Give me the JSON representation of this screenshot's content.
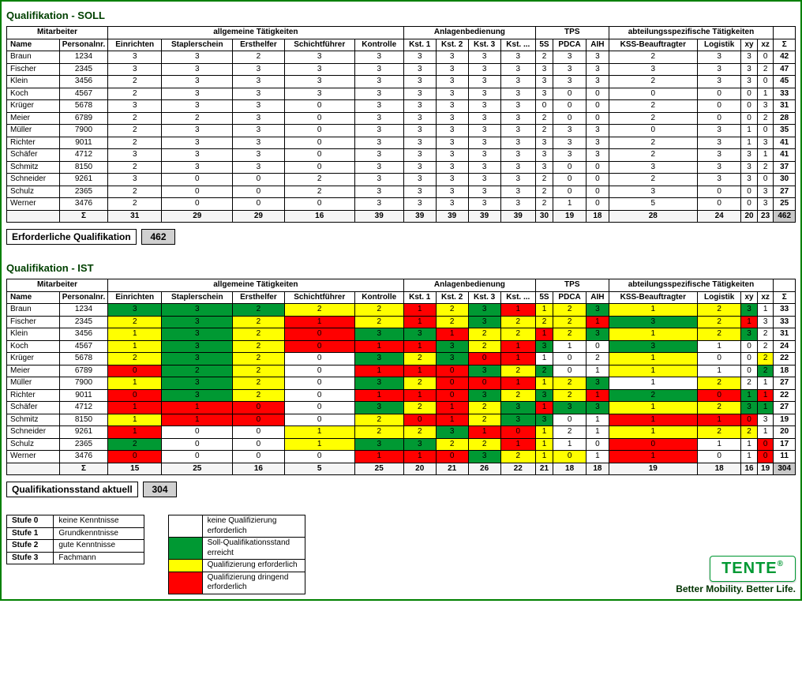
{
  "soll": {
    "title": "Qualifikation - SOLL",
    "groupHeaders": [
      "Mitarbeiter",
      "allgemeine Tätigkeiten",
      "Anlagenbedienung",
      "TPS",
      "abteilungsspezifische Tätigkeiten",
      ""
    ],
    "cols": [
      "Name",
      "Personalnr.",
      "Einrichten",
      "Staplerschein",
      "Ersthelfer",
      "Schichtführer",
      "Kontrolle",
      "Kst. 1",
      "Kst. 2",
      "Kst. 3",
      "Kst. ...",
      "5S",
      "PDCA",
      "AIH",
      "KSS-Beauftragter",
      "Logistik",
      "xy",
      "xz",
      "Σ"
    ],
    "rows": [
      {
        "name": "Braun",
        "pnr": "1234",
        "v": [
          3,
          3,
          2,
          3,
          3,
          3,
          3,
          3,
          3,
          2,
          3,
          3,
          2,
          3,
          3,
          0
        ],
        "sum": 42
      },
      {
        "name": "Fischer",
        "pnr": "2345",
        "v": [
          3,
          3,
          3,
          3,
          3,
          3,
          3,
          3,
          3,
          3,
          3,
          3,
          3,
          3,
          3,
          2
        ],
        "sum": 47
      },
      {
        "name": "Klein",
        "pnr": "3456",
        "v": [
          2,
          3,
          3,
          3,
          3,
          3,
          3,
          3,
          3,
          3,
          3,
          3,
          2,
          3,
          3,
          0
        ],
        "sum": 45
      },
      {
        "name": "Koch",
        "pnr": "4567",
        "v": [
          2,
          3,
          3,
          3,
          3,
          3,
          3,
          3,
          3,
          3,
          0,
          0,
          0,
          0,
          0,
          1
        ],
        "sum": 33
      },
      {
        "name": "Krüger",
        "pnr": "5678",
        "v": [
          3,
          3,
          3,
          0,
          3,
          3,
          3,
          3,
          3,
          0,
          0,
          0,
          2,
          0,
          0,
          3
        ],
        "sum": 31
      },
      {
        "name": "Meier",
        "pnr": "6789",
        "v": [
          2,
          2,
          3,
          0,
          3,
          3,
          3,
          3,
          3,
          2,
          0,
          0,
          2,
          0,
          0,
          2
        ],
        "sum": 28
      },
      {
        "name": "Müller",
        "pnr": "7900",
        "v": [
          2,
          3,
          3,
          0,
          3,
          3,
          3,
          3,
          3,
          2,
          3,
          3,
          0,
          3,
          1,
          0
        ],
        "sum": 35
      },
      {
        "name": "Richter",
        "pnr": "9011",
        "v": [
          2,
          3,
          3,
          0,
          3,
          3,
          3,
          3,
          3,
          3,
          3,
          3,
          2,
          3,
          1,
          3
        ],
        "sum": 41
      },
      {
        "name": "Schäfer",
        "pnr": "4712",
        "v": [
          3,
          3,
          3,
          0,
          3,
          3,
          3,
          3,
          3,
          3,
          3,
          3,
          2,
          3,
          3,
          1
        ],
        "sum": 41
      },
      {
        "name": "Schmitz",
        "pnr": "8150",
        "v": [
          2,
          3,
          3,
          0,
          3,
          3,
          3,
          3,
          3,
          3,
          0,
          0,
          3,
          3,
          3,
          2
        ],
        "sum": 37
      },
      {
        "name": "Schneider",
        "pnr": "9261",
        "v": [
          3,
          0,
          0,
          2,
          3,
          3,
          3,
          3,
          3,
          2,
          0,
          0,
          2,
          3,
          3,
          0
        ],
        "sum": 30
      },
      {
        "name": "Schulz",
        "pnr": "2365",
        "v": [
          2,
          0,
          0,
          2,
          3,
          3,
          3,
          3,
          3,
          2,
          0,
          0,
          3,
          0,
          0,
          3
        ],
        "sum": 27
      },
      {
        "name": "Werner",
        "pnr": "3476",
        "v": [
          2,
          0,
          0,
          0,
          3,
          3,
          3,
          3,
          3,
          2,
          1,
          0,
          5,
          0,
          0,
          3
        ],
        "sum": 25
      }
    ],
    "colSums": [
      31,
      29,
      29,
      16,
      39,
      39,
      39,
      39,
      39,
      30,
      19,
      18,
      28,
      24,
      20,
      23
    ],
    "total": 462,
    "summaryLabel": "Erforderliche Qualifikation",
    "summaryValue": 462
  },
  "ist": {
    "title": "Qualifikation - IST",
    "rows": [
      {
        "name": "Braun",
        "pnr": "1234",
        "v": [
          [
            3,
            "g"
          ],
          [
            3,
            "g"
          ],
          [
            2,
            "g"
          ],
          [
            2,
            "y"
          ],
          [
            2,
            "y"
          ],
          [
            1,
            "r"
          ],
          [
            2,
            "y"
          ],
          [
            3,
            "g"
          ],
          [
            1,
            "r"
          ],
          [
            1,
            "y"
          ],
          [
            2,
            "y"
          ],
          [
            3,
            "g"
          ],
          [
            1,
            "y"
          ],
          [
            2,
            "y"
          ],
          [
            3,
            "g"
          ],
          [
            1,
            ""
          ]
        ],
        "sum": 33
      },
      {
        "name": "Fischer",
        "pnr": "2345",
        "v": [
          [
            2,
            "y"
          ],
          [
            3,
            "g"
          ],
          [
            2,
            "y"
          ],
          [
            1,
            "r"
          ],
          [
            2,
            "y"
          ],
          [
            1,
            "r"
          ],
          [
            2,
            "y"
          ],
          [
            3,
            "g"
          ],
          [
            2,
            "y"
          ],
          [
            2,
            "y"
          ],
          [
            2,
            "y"
          ],
          [
            1,
            "r"
          ],
          [
            3,
            "g"
          ],
          [
            2,
            "y"
          ],
          [
            1,
            "r"
          ],
          [
            3,
            ""
          ]
        ],
        "sum": 33
      },
      {
        "name": "Klein",
        "pnr": "3456",
        "v": [
          [
            1,
            "y"
          ],
          [
            3,
            "g"
          ],
          [
            2,
            "y"
          ],
          [
            0,
            "r"
          ],
          [
            3,
            "g"
          ],
          [
            3,
            "g"
          ],
          [
            1,
            "r"
          ],
          [
            2,
            "y"
          ],
          [
            2,
            "y"
          ],
          [
            1,
            "r"
          ],
          [
            2,
            "y"
          ],
          [
            3,
            "g"
          ],
          [
            1,
            "y"
          ],
          [
            2,
            "y"
          ],
          [
            3,
            "g"
          ],
          [
            2,
            ""
          ]
        ],
        "sum": 31
      },
      {
        "name": "Koch",
        "pnr": "4567",
        "v": [
          [
            1,
            "y"
          ],
          [
            3,
            "g"
          ],
          [
            2,
            "y"
          ],
          [
            0,
            "r"
          ],
          [
            1,
            "r"
          ],
          [
            1,
            "r"
          ],
          [
            3,
            "g"
          ],
          [
            2,
            "y"
          ],
          [
            1,
            "r"
          ],
          [
            3,
            "g"
          ],
          [
            1,
            ""
          ],
          [
            0,
            ""
          ],
          [
            3,
            "g"
          ],
          [
            1,
            ""
          ],
          [
            0,
            ""
          ],
          [
            2,
            ""
          ]
        ],
        "sum": 24
      },
      {
        "name": "Krüger",
        "pnr": "5678",
        "v": [
          [
            2,
            "y"
          ],
          [
            3,
            "g"
          ],
          [
            2,
            "y"
          ],
          [
            0,
            ""
          ],
          [
            3,
            "g"
          ],
          [
            2,
            "y"
          ],
          [
            3,
            "g"
          ],
          [
            0,
            "r"
          ],
          [
            1,
            "r"
          ],
          [
            1,
            ""
          ],
          [
            0,
            ""
          ],
          [
            2,
            ""
          ],
          [
            1,
            "y"
          ],
          [
            0,
            ""
          ],
          [
            0,
            ""
          ],
          [
            2,
            "y"
          ]
        ],
        "sum": 22
      },
      {
        "name": "Meier",
        "pnr": "6789",
        "v": [
          [
            0,
            "r"
          ],
          [
            2,
            "g"
          ],
          [
            2,
            "y"
          ],
          [
            0,
            ""
          ],
          [
            1,
            "r"
          ],
          [
            1,
            "r"
          ],
          [
            0,
            "r"
          ],
          [
            3,
            "g"
          ],
          [
            2,
            "y"
          ],
          [
            2,
            "g"
          ],
          [
            0,
            ""
          ],
          [
            1,
            ""
          ],
          [
            1,
            "y"
          ],
          [
            1,
            ""
          ],
          [
            0,
            ""
          ],
          [
            2,
            "g"
          ]
        ],
        "sum": 18
      },
      {
        "name": "Müller",
        "pnr": "7900",
        "v": [
          [
            1,
            "y"
          ],
          [
            3,
            "g"
          ],
          [
            2,
            "y"
          ],
          [
            0,
            ""
          ],
          [
            3,
            "g"
          ],
          [
            2,
            "y"
          ],
          [
            0,
            "r"
          ],
          [
            0,
            "r"
          ],
          [
            1,
            "r"
          ],
          [
            1,
            "y"
          ],
          [
            2,
            "y"
          ],
          [
            3,
            "g"
          ],
          [
            1,
            ""
          ],
          [
            2,
            "y"
          ],
          [
            2,
            ""
          ],
          [
            1,
            ""
          ]
        ],
        "sum": 27
      },
      {
        "name": "Richter",
        "pnr": "9011",
        "v": [
          [
            0,
            "r"
          ],
          [
            3,
            "g"
          ],
          [
            2,
            "y"
          ],
          [
            0,
            ""
          ],
          [
            1,
            "r"
          ],
          [
            1,
            "r"
          ],
          [
            0,
            "r"
          ],
          [
            3,
            "g"
          ],
          [
            2,
            "y"
          ],
          [
            3,
            "g"
          ],
          [
            2,
            "y"
          ],
          [
            1,
            "r"
          ],
          [
            2,
            "g"
          ],
          [
            0,
            "r"
          ],
          [
            1,
            "g"
          ],
          [
            1,
            "r"
          ]
        ],
        "sum": 22
      },
      {
        "name": "Schäfer",
        "pnr": "4712",
        "v": [
          [
            1,
            "r"
          ],
          [
            1,
            "r"
          ],
          [
            0,
            "r"
          ],
          [
            0,
            ""
          ],
          [
            3,
            "g"
          ],
          [
            2,
            "y"
          ],
          [
            1,
            "r"
          ],
          [
            2,
            "y"
          ],
          [
            3,
            "g"
          ],
          [
            1,
            "r"
          ],
          [
            3,
            "g"
          ],
          [
            3,
            "g"
          ],
          [
            1,
            "y"
          ],
          [
            2,
            "y"
          ],
          [
            3,
            "g"
          ],
          [
            1,
            "g"
          ]
        ],
        "sum": 27
      },
      {
        "name": "Schmitz",
        "pnr": "8150",
        "v": [
          [
            1,
            "y"
          ],
          [
            1,
            "r"
          ],
          [
            0,
            "r"
          ],
          [
            0,
            ""
          ],
          [
            2,
            "y"
          ],
          [
            0,
            "r"
          ],
          [
            1,
            "r"
          ],
          [
            2,
            "y"
          ],
          [
            3,
            "g"
          ],
          [
            3,
            "g"
          ],
          [
            0,
            ""
          ],
          [
            1,
            ""
          ],
          [
            1,
            "r"
          ],
          [
            1,
            "r"
          ],
          [
            0,
            "r"
          ],
          [
            3,
            ""
          ]
        ],
        "sum": 19
      },
      {
        "name": "Schneider",
        "pnr": "9261",
        "v": [
          [
            1,
            "r"
          ],
          [
            0,
            ""
          ],
          [
            0,
            ""
          ],
          [
            1,
            "y"
          ],
          [
            2,
            "y"
          ],
          [
            2,
            "y"
          ],
          [
            3,
            "g"
          ],
          [
            1,
            "r"
          ],
          [
            0,
            "r"
          ],
          [
            1,
            "y"
          ],
          [
            2,
            ""
          ],
          [
            1,
            ""
          ],
          [
            1,
            "y"
          ],
          [
            2,
            "y"
          ],
          [
            2,
            "y"
          ],
          [
            1,
            ""
          ]
        ],
        "sum": 20
      },
      {
        "name": "Schulz",
        "pnr": "2365",
        "v": [
          [
            2,
            "g"
          ],
          [
            0,
            ""
          ],
          [
            0,
            ""
          ],
          [
            1,
            "y"
          ],
          [
            3,
            "g"
          ],
          [
            3,
            "g"
          ],
          [
            2,
            "y"
          ],
          [
            2,
            "y"
          ],
          [
            1,
            "r"
          ],
          [
            1,
            "y"
          ],
          [
            1,
            ""
          ],
          [
            0,
            ""
          ],
          [
            0,
            "r"
          ],
          [
            1,
            ""
          ],
          [
            1,
            ""
          ],
          [
            0,
            "r"
          ]
        ],
        "sum": 17
      },
      {
        "name": "Werner",
        "pnr": "3476",
        "v": [
          [
            0,
            "r"
          ],
          [
            0,
            ""
          ],
          [
            0,
            ""
          ],
          [
            0,
            ""
          ],
          [
            1,
            "r"
          ],
          [
            1,
            "r"
          ],
          [
            0,
            "r"
          ],
          [
            3,
            "g"
          ],
          [
            2,
            "y"
          ],
          [
            1,
            "y"
          ],
          [
            0,
            "y"
          ],
          [
            1,
            ""
          ],
          [
            1,
            "r"
          ],
          [
            0,
            ""
          ],
          [
            1,
            ""
          ],
          [
            0,
            "r"
          ]
        ],
        "sum": 11
      }
    ],
    "colSums": [
      15,
      25,
      16,
      5,
      25,
      20,
      21,
      26,
      22,
      21,
      18,
      18,
      19,
      18,
      16,
      19
    ],
    "total": 304,
    "summaryLabel": "Qualifikationsstand aktuell",
    "summaryValue": 304
  },
  "levels": [
    {
      "k": "Stufe 0",
      "d": "keine Kenntnisse"
    },
    {
      "k": "Stufe 1",
      "d": "Grundkenntnisse"
    },
    {
      "k": "Stufe 2",
      "d": "gute Kenntnisse"
    },
    {
      "k": "Stufe 3",
      "d": "Fachmann"
    }
  ],
  "legend": [
    {
      "c": "",
      "text": "keine Qualifizierung erforderlich"
    },
    {
      "c": "g",
      "text": "Soll-Qualifikationsstand erreicht"
    },
    {
      "c": "y",
      "text": "Qualifizierung erforderlich"
    },
    {
      "c": "r",
      "text": "Qualifizierung dringend erforderlich"
    }
  ],
  "brand": {
    "name": "TENTE",
    "tagline": "Better Mobility. Better Life."
  }
}
